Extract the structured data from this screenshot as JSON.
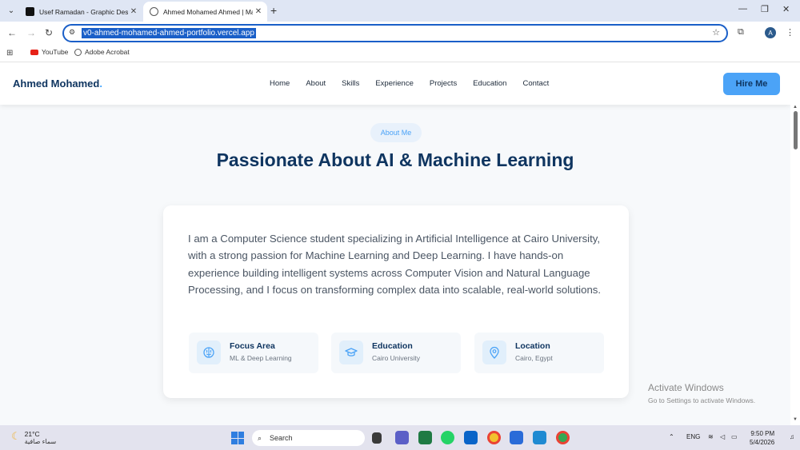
{
  "browser": {
    "tabs": [
      {
        "title": "Usef Ramadan - Graphic Design",
        "active": false
      },
      {
        "title": "Ahmed Mohamed Ahmed | Ma",
        "active": true
      }
    ],
    "url": "v0-ahmed-mohamed-ahmed-portfolio.vercel.app",
    "profile_initial": "A",
    "bookmarks": [
      "YouTube",
      "Adobe Acrobat"
    ]
  },
  "site": {
    "logo": "Ahmed Mohamed",
    "logo_dot": ".",
    "nav_links": [
      "Home",
      "About",
      "Skills",
      "Experience",
      "Projects",
      "Education",
      "Contact"
    ],
    "hire_button": "Hire Me",
    "section_badge": "About Me",
    "headline": "Passionate About AI & Machine Learning",
    "bio": "I am a Computer Science student specializing in Artificial Intelligence at Cairo University, with a strong passion for Machine Learning and Deep Learning. I have hands-on experience building intelligent systems across Computer Vision and Natural Language Processing, and I focus on transforming complex data into scalable, real-world solutions.",
    "info_cards": [
      {
        "icon": "brain-icon",
        "label": "Focus Area",
        "value": "ML & Deep Learning"
      },
      {
        "icon": "graduation-cap-icon",
        "label": "Education",
        "value": "Cairo University"
      },
      {
        "icon": "location-pin-icon",
        "label": "Location",
        "value": "Cairo, Egypt"
      }
    ]
  },
  "os": {
    "watermark_title": "Activate Windows",
    "watermark_sub": "Go to Settings to activate Windows.",
    "weather_temp": "21°C",
    "weather_desc": "سماء صافية",
    "search_placeholder": "Search",
    "language": "ENG",
    "time": "9:50 PM",
    "date": "5/4/2026"
  },
  "colors": {
    "accent": "#4ba3f7",
    "navy": "#0f3560"
  }
}
